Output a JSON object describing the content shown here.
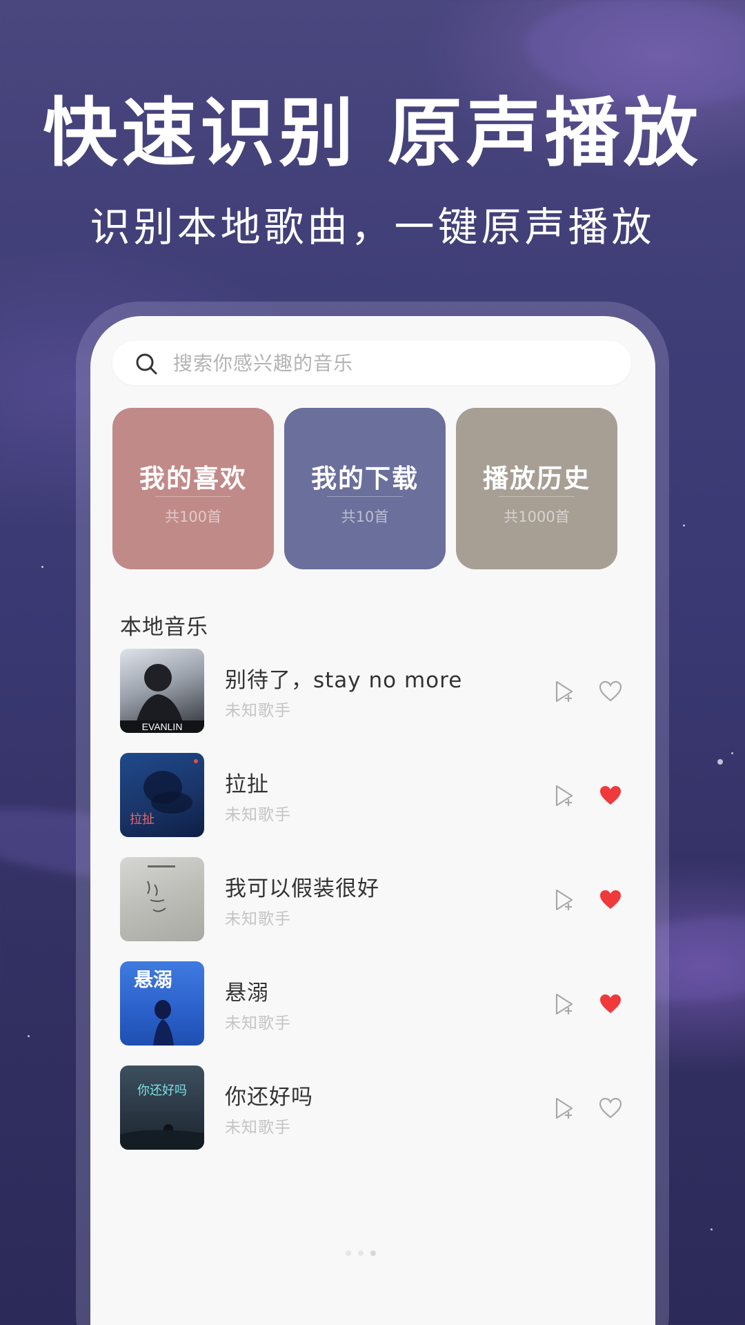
{
  "hero": {
    "title": "快速识别 原声播放",
    "subtitle": "识别本地歌曲，一键原声播放"
  },
  "search": {
    "icon": "search-icon",
    "placeholder": "搜索你感兴趣的音乐"
  },
  "cards": [
    {
      "title": "我的喜欢",
      "count": "共100首",
      "color": "#c08a88"
    },
    {
      "title": "我的下载",
      "count": "共10首",
      "color": "#6a6f9b"
    },
    {
      "title": "播放历史",
      "count": "共1000首",
      "color": "#a79e94"
    }
  ],
  "local_music": {
    "section_title": "本地音乐",
    "songs": [
      {
        "title": "别待了，stay no more",
        "artist": "未知歌手",
        "liked": false,
        "cover_text": "EVANLIN"
      },
      {
        "title": "拉扯",
        "artist": "未知歌手",
        "liked": true,
        "cover_text": "拉扯"
      },
      {
        "title": "我可以假装很好",
        "artist": "未知歌手",
        "liked": true,
        "cover_text": ""
      },
      {
        "title": "悬溺",
        "artist": "未知歌手",
        "liked": true,
        "cover_text": "悬溺"
      },
      {
        "title": "你还好吗",
        "artist": "未知歌手",
        "liked": false,
        "cover_text": "你还好吗"
      }
    ]
  },
  "colors": {
    "heart_liked": "#f0393b",
    "icon_gray": "#a8a8a8",
    "background": "#3b3973"
  }
}
